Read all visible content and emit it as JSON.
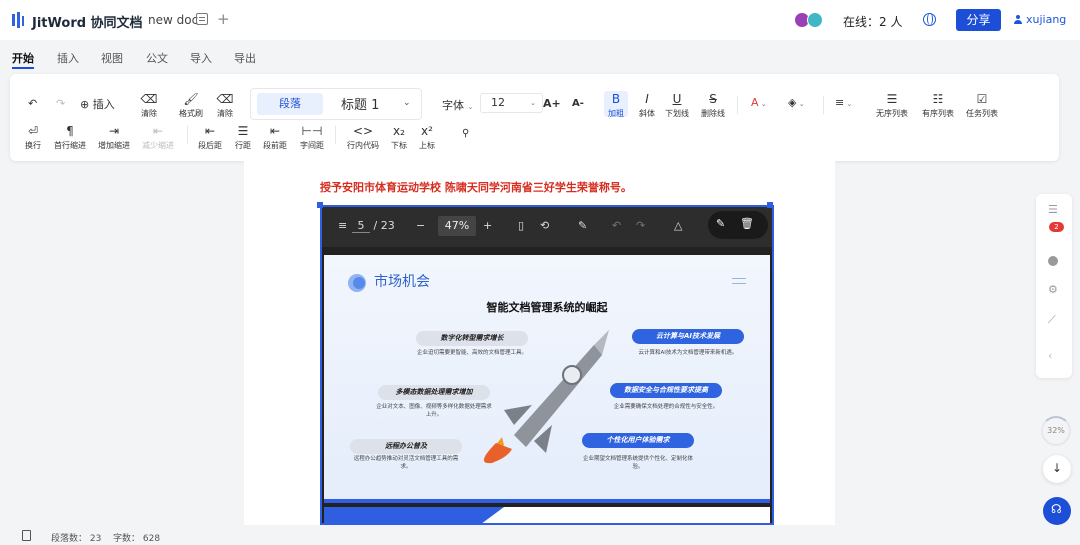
{
  "header": {
    "app_title": "JitWord 协同文档",
    "doc_title": "new doc",
    "add_tab": "+",
    "online": "在线：2 人",
    "share": "分享",
    "user": "xujiang"
  },
  "menu_tabs": [
    "开始",
    "插入",
    "视图",
    "公文",
    "导入",
    "导出"
  ],
  "toolbar": {
    "insert": "插入",
    "clear": "清除",
    "format_painter": "格式刷",
    "clear2": "清除",
    "paragraph": "段落",
    "heading": "标题 1",
    "font": "字体",
    "font_size": "12",
    "bold": "加粗",
    "italic": "斜体",
    "underline": "下划线",
    "strike": "删除线",
    "bullet_list": "无序列表",
    "ordered_list": "有序列表",
    "task_list": "任务列表",
    "wrap": "换行",
    "first_indent": "首行缩进",
    "add_indent": "增加缩进",
    "reduce_indent": "减少缩进",
    "para_after": "段后距",
    "line_height": "行距",
    "para_before": "段前距",
    "letter_spacing": "字间距",
    "inline_code": "行内代码",
    "subscript": "下标",
    "superscript": "上标"
  },
  "document": {
    "red_text": "授予安阳市体育运动学校 陈啸天同学河南省三好学生荣誉称号。"
  },
  "pdf": {
    "page": "5",
    "total": "/ 23",
    "zoom": "47%"
  },
  "slide": {
    "title": "市场机会",
    "heading": "智能文档管理系统的崛起",
    "items": [
      {
        "label": "数字化转型需求增长",
        "desc": "企业迫切需要更智能、高效的文档管理工具。"
      },
      {
        "label": "云计算与AI技术发展",
        "desc": "云计算和AI技术为文档管理带来新机遇。"
      },
      {
        "label": "多模态数据处理需求增加",
        "desc": "企业对文本、图像、视频等多样化数据处理需求上升。"
      },
      {
        "label": "数据安全与合规性要求提高",
        "desc": "企业需要确保文档处理的合规性与安全性。"
      },
      {
        "label": "远程办公普及",
        "desc": "远程办公趋势推动对灵活文档管理工具的需求。"
      },
      {
        "label": "个性化用户体验需求",
        "desc": "企业期望文档管理系统提供个性化、定制化体验。"
      }
    ]
  },
  "sidebar": {
    "badge": "2",
    "progress": "32%"
  },
  "status": {
    "paragraphs": "段落数：  23",
    "words": "字数：  628"
  },
  "colors": {
    "accent": "#1d4ed8",
    "red_text": "#d62d20",
    "badge": "#e53935"
  }
}
